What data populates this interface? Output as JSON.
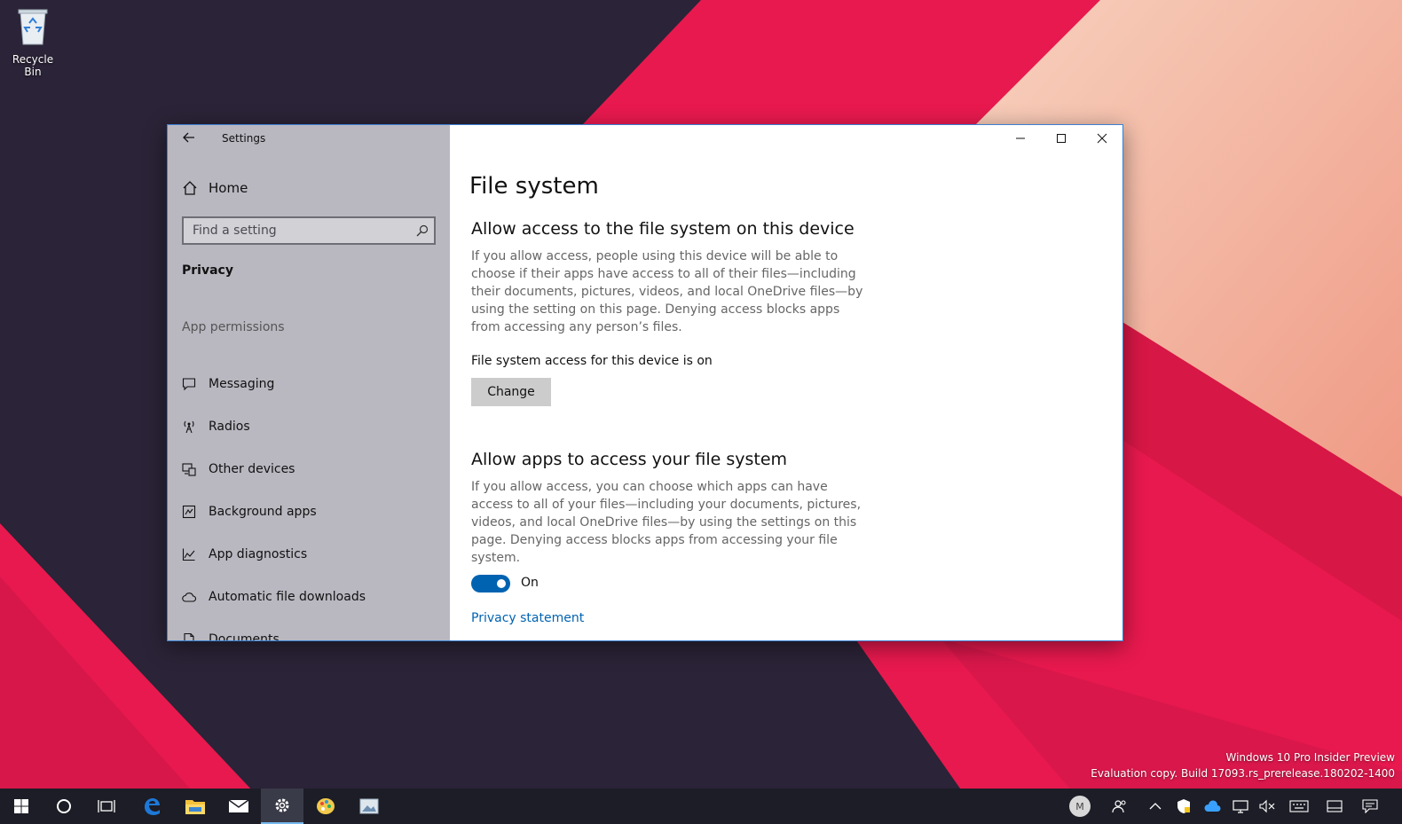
{
  "desktop": {
    "recycle_bin_label": "Recycle Bin",
    "watermark_line1": "Windows 10 Pro Insider Preview",
    "watermark_line2": "Evaluation copy. Build 17093.rs_prerelease.180202-1400",
    "colors": {
      "dark": "#2b2337",
      "red": "#e8194e",
      "peach": "#f5c0a8"
    }
  },
  "window": {
    "title": "Settings",
    "sidebar": {
      "home_label": "Home",
      "search_placeholder": "Find a setting",
      "section_label": "Privacy",
      "group_label": "App permissions",
      "items": [
        {
          "label": "Messaging",
          "icon": "message-icon"
        },
        {
          "label": "Radios",
          "icon": "radio-tower-icon"
        },
        {
          "label": "Other devices",
          "icon": "devices-icon"
        },
        {
          "label": "Background apps",
          "icon": "background-apps-icon"
        },
        {
          "label": "App diagnostics",
          "icon": "diagnostics-chart-icon"
        },
        {
          "label": "Automatic file downloads",
          "icon": "cloud-icon"
        },
        {
          "label": "Documents",
          "icon": "document-icon"
        }
      ]
    },
    "content": {
      "page_title": "File system",
      "section1": {
        "heading": "Allow access to the file system on this device",
        "description": "If you allow access, people using this device will be able to choose if their apps have access to all of their files—including their documents, pictures, videos, and local OneDrive files—by using the setting on this page. Denying access blocks apps from accessing any person’s files.",
        "status": "File system access for this device is on",
        "button_label": "Change"
      },
      "section2": {
        "heading": "Allow apps to access your file system",
        "description": "If you allow access, you can choose which apps can have access to all of your files—including your documents, pictures, videos, and local OneDrive files—by using the settings on this page. Denying access blocks apps from accessing your file system.",
        "toggle_state": "On",
        "toggle_on": true
      },
      "privacy_link": "Privacy statement"
    },
    "accent_color": "#0063b1"
  },
  "taskbar": {
    "user_initial": "M",
    "pinned": [
      "start-icon",
      "cortana-icon",
      "task-view-icon",
      "edge-icon",
      "file-explorer-icon",
      "mail-icon",
      "settings-icon",
      "paint-icon",
      "photos-icon"
    ],
    "active_app": "settings-icon",
    "tray": [
      "people-icon",
      "chevron-up-icon",
      "security-icon",
      "onedrive-icon",
      "network-icon",
      "volume-muted-icon",
      "keyboard-icon",
      "tablet-icon",
      "action-center-icon"
    ]
  }
}
